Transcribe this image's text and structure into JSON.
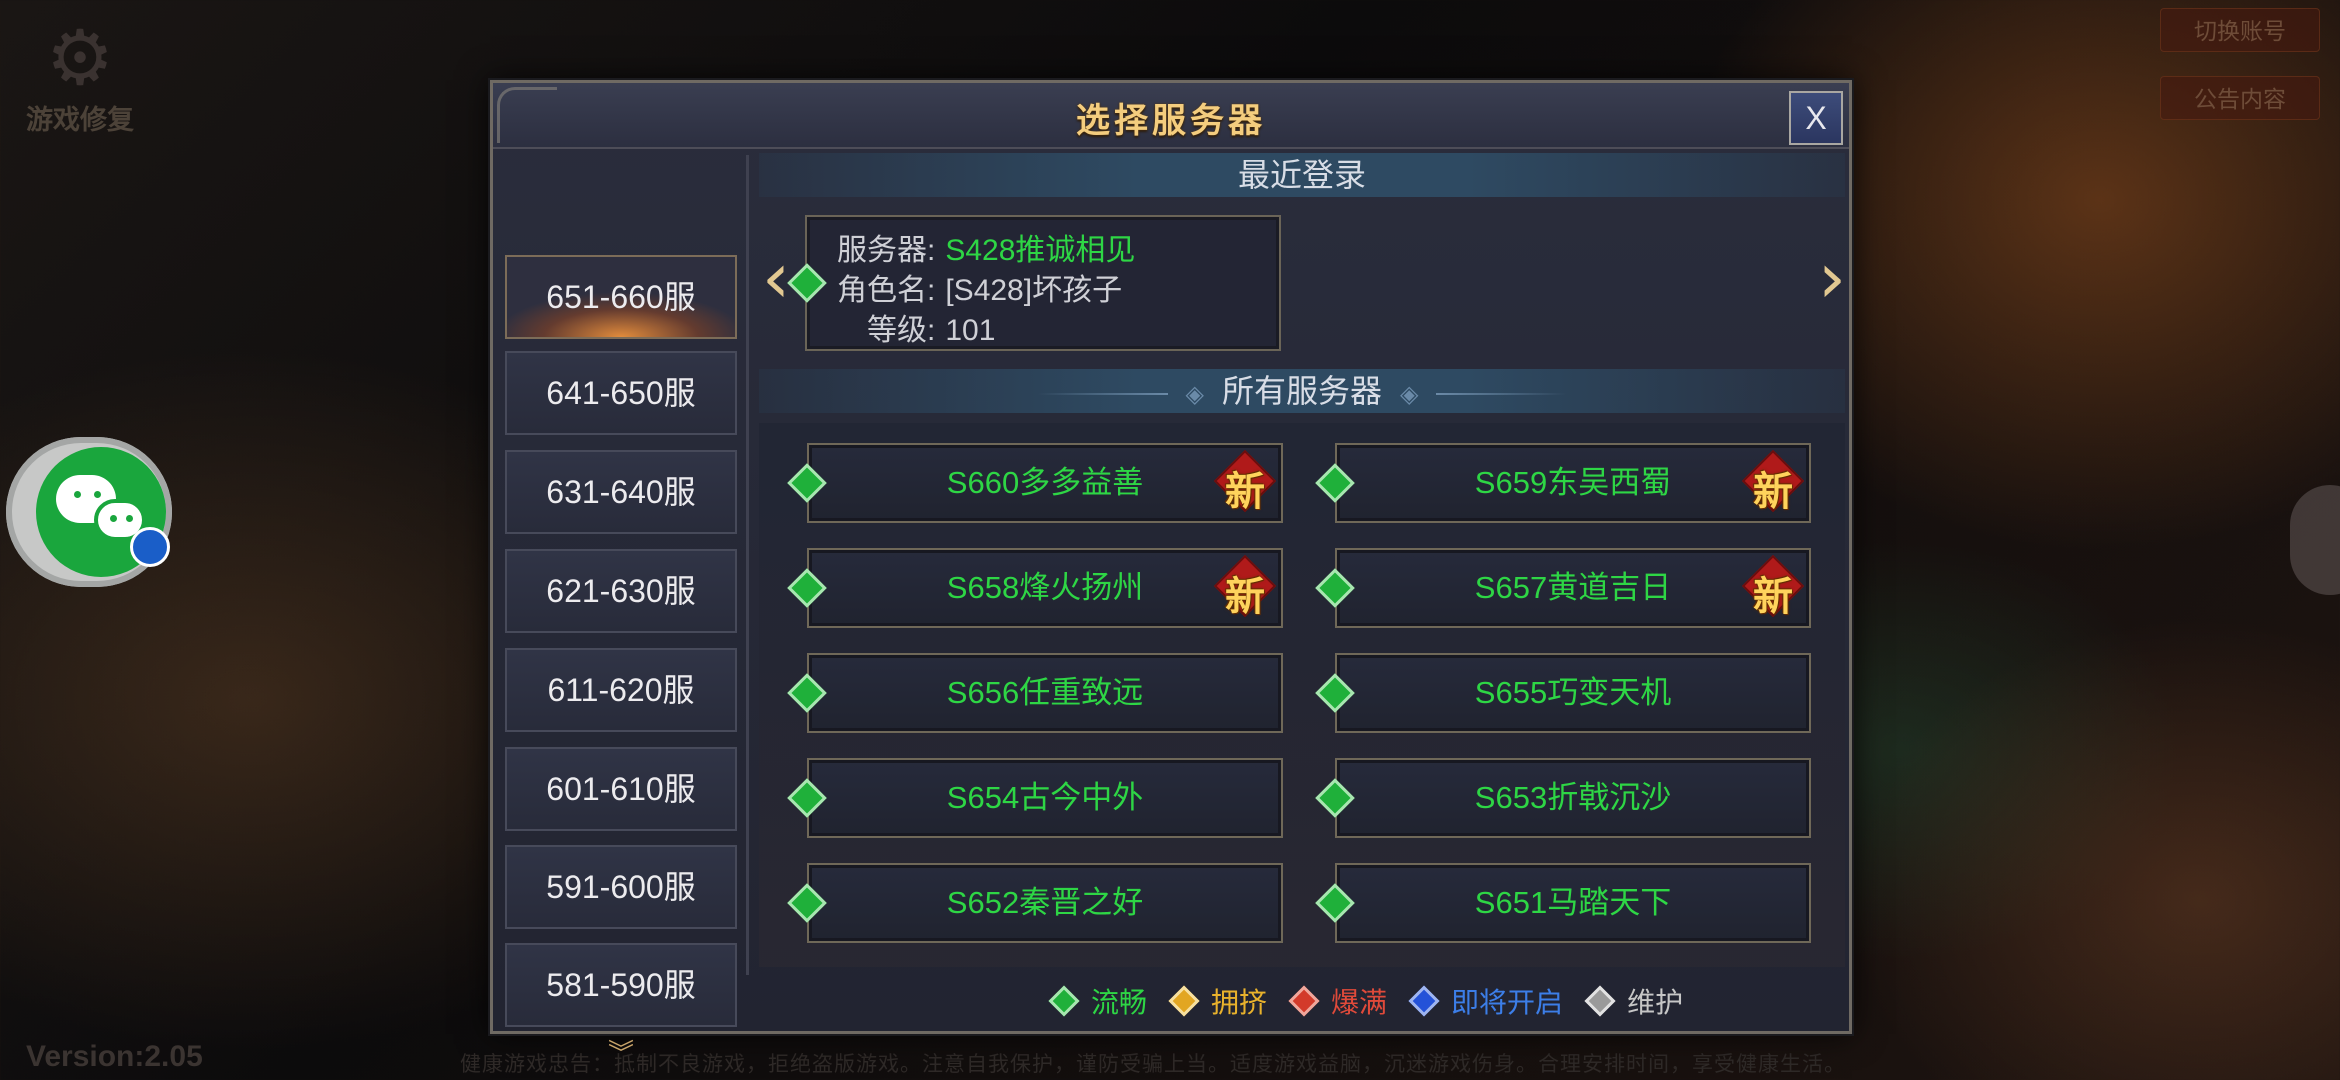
{
  "background": {
    "repair_label": "游戏修复",
    "top_right_buttons": [
      "切换账号",
      "公告内容"
    ],
    "version": "Version:2.05",
    "notice": "健康游戏忠告：抵制不良游戏，拒绝盗版游戏。注意自我保护，谨防受骗上当。适度游戏益脑，沉迷游戏伤身。合理安排时间，享受健康生活。"
  },
  "dialog": {
    "title": "选择服务器",
    "close_label": "X",
    "ranges": [
      "651-660服",
      "641-650服",
      "631-640服",
      "621-630服",
      "611-620服",
      "601-610服",
      "591-600服",
      "581-590服"
    ],
    "active_range_index": 0,
    "recent": {
      "header": "最近登录",
      "server_label": "服务器:",
      "server_value": "S428推诚相见",
      "role_label": "角色名:",
      "role_value": "[S428]坏孩子",
      "level_label": "等级:",
      "level_value": "101"
    },
    "all_servers_header": "所有服务器",
    "new_badge_text": "新",
    "servers": [
      {
        "name": "S660多多益善",
        "status": "green",
        "is_new": true
      },
      {
        "name": "S659东吴西蜀",
        "status": "green",
        "is_new": true
      },
      {
        "name": "S658烽火扬州",
        "status": "green",
        "is_new": true
      },
      {
        "name": "S657黄道吉日",
        "status": "green",
        "is_new": true
      },
      {
        "name": "S656任重致远",
        "status": "green",
        "is_new": false
      },
      {
        "name": "S655巧变天机",
        "status": "green",
        "is_new": false
      },
      {
        "name": "S654古今中外",
        "status": "green",
        "is_new": false
      },
      {
        "name": "S653折戟沉沙",
        "status": "green",
        "is_new": false
      },
      {
        "name": "S652秦晋之好",
        "status": "green",
        "is_new": false
      },
      {
        "name": "S651马踏天下",
        "status": "green",
        "is_new": false
      }
    ],
    "legend": [
      {
        "label": "流畅",
        "color": "green"
      },
      {
        "label": "拥挤",
        "color": "yellow"
      },
      {
        "label": "爆满",
        "color": "red"
      },
      {
        "label": "即将开启",
        "color": "blue"
      },
      {
        "label": "维护",
        "color": "gray"
      }
    ]
  },
  "colors": {
    "accent_gold": "#f4cd7e",
    "server_green": "#2ed645",
    "badge_red": "#b01a1a"
  }
}
